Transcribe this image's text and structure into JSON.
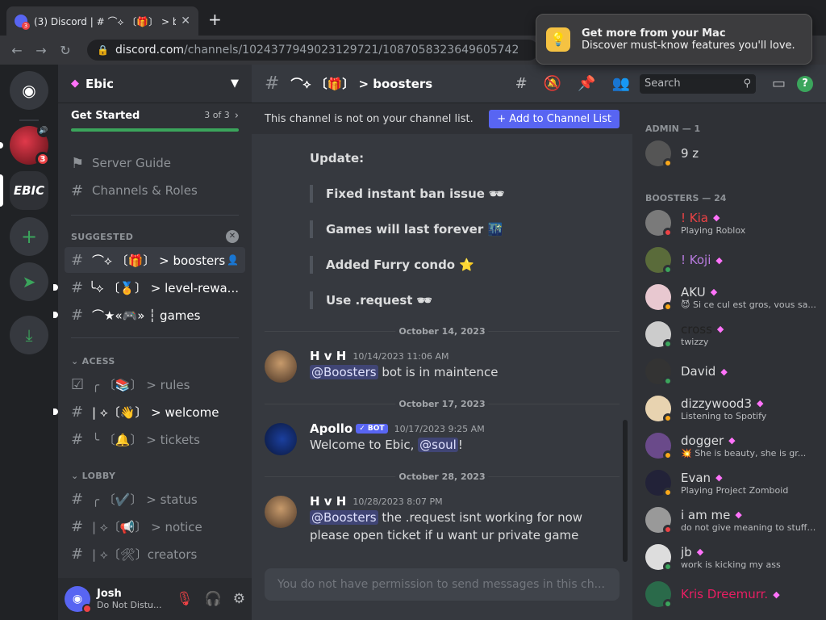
{
  "browser": {
    "tab_title": "(3) Discord | # ⌒⟡ 〔🎁〕 > boo",
    "tab_badge": "3",
    "url_host": "discord.com",
    "url_path": "/channels/1024377949023129721/1087058323649605742",
    "notification": {
      "title": "Get more from your Mac",
      "body": "Discover must-know features you'll love."
    }
  },
  "servers": {
    "red_badge": "3",
    "ebic_label": "EBIC"
  },
  "sidebar": {
    "guild_name": "Ebic",
    "get_started": {
      "label": "Get Started",
      "progress_text": "3 of 3",
      "progress_fraction": 1.0
    },
    "top_items": [
      {
        "icon": "signpost-icon",
        "label": "Server Guide"
      },
      {
        "icon": "channels-roles-icon",
        "label": "Channels & Roles"
      }
    ],
    "categories": {
      "suggested": "SUGGESTED",
      "acess": "ACESS",
      "lobby": "LOBBY"
    },
    "suggested_channels": [
      {
        "label": "⌒⟡ 〔🎁〕 > boosters",
        "selected": true
      },
      {
        "label": "╰⟡ 〔🏅〕 > level-rewa...",
        "selected": false
      },
      {
        "label": "⌒★«🎮» ┆ games",
        "selected": false
      }
    ],
    "acess_channels": [
      {
        "label": "╭ 〔📚〕 > rules"
      },
      {
        "label": "| ⟡〔👋〕 > welcome"
      },
      {
        "label": "╰ 〔🔔〕 > tickets"
      }
    ],
    "lobby_channels": [
      {
        "label": "╭ 〔✔️〕 > status"
      },
      {
        "label": "| ⟡〔📢〕 > notice"
      },
      {
        "label": "| ⟡〔🛠〕creators"
      }
    ],
    "user": {
      "name": "Josh",
      "status": "Do Not Distu..."
    }
  },
  "channel": {
    "name": "⌒⟡ 〔🎁〕 > boosters",
    "search_placeholder": "Search",
    "notice_text": "This channel is not on your channel list.",
    "notice_button": "+ Add to Channel List",
    "composer_placeholder": "You do not have permission to send messages in this ch..."
  },
  "messages": {
    "update_title": "Update:",
    "update_lines": [
      "Fixed instant ban issue 🕶",
      "Games will last forever 🌃",
      "Added Furry condo ⭐",
      "Use .request 🕶"
    ],
    "dates": [
      "October 14, 2023",
      "October 17, 2023",
      "October 28, 2023"
    ],
    "list": [
      {
        "author": "H v H",
        "time": "10/14/2023 11:06 AM",
        "mention": "@Boosters",
        "text": " bot is in maintence",
        "line2": ""
      },
      {
        "author": "Apollo",
        "bot_label": "✓ BOT",
        "time": "10/17/2023 9:25 AM",
        "text_before": "Welcome to Ebic, ",
        "mention": "@soul",
        "text_after": "!"
      },
      {
        "author": "H v H",
        "time": "10/28/2023 8:07 PM",
        "mention": "@Boosters",
        "text": " the .request isnt working for now",
        "line2": "please open ticket if u want ur private game"
      }
    ]
  },
  "members": {
    "admin_header": "ADMIN — 1",
    "boosters_header": "BOOSTERS — 24",
    "admin": [
      {
        "name": "9 z",
        "activity": ""
      }
    ],
    "boosters": [
      {
        "name": "! Kia",
        "activity": "Playing Roblox",
        "color": "#ed4245"
      },
      {
        "name": "! Koji",
        "activity": "",
        "color": "#b97ce0"
      },
      {
        "name": "AKU",
        "activity": "😈 Si ce cul est gros, vous sa...",
        "color": "#dcddde"
      },
      {
        "name": "cross",
        "activity": "twizzy",
        "color": "#222222"
      },
      {
        "name": "David",
        "activity": "",
        "color": "#dcddde"
      },
      {
        "name": "dizzywood3",
        "activity": "Listening to Spotify",
        "color": "#dcddde"
      },
      {
        "name": "dogger",
        "activity": "💥 She is beauty, she is gr...",
        "color": "#dcddde"
      },
      {
        "name": "Evan",
        "activity": "Playing Project Zomboid",
        "color": "#dcddde"
      },
      {
        "name": "i am me",
        "activity": "do not give meaning to stuff t...",
        "color": "#dcddde"
      },
      {
        "name": "jb",
        "activity": "work is kicking my ass",
        "color": "#dcddde"
      },
      {
        "name": "Kris Dreemurr.",
        "activity": "",
        "color": "#e91e63"
      }
    ]
  },
  "colors": {
    "accent": "#5865f2",
    "online": "#3ba55c",
    "dnd": "#ed4245",
    "idle": "#faa81a",
    "booster_gem": "#ff73fa"
  }
}
